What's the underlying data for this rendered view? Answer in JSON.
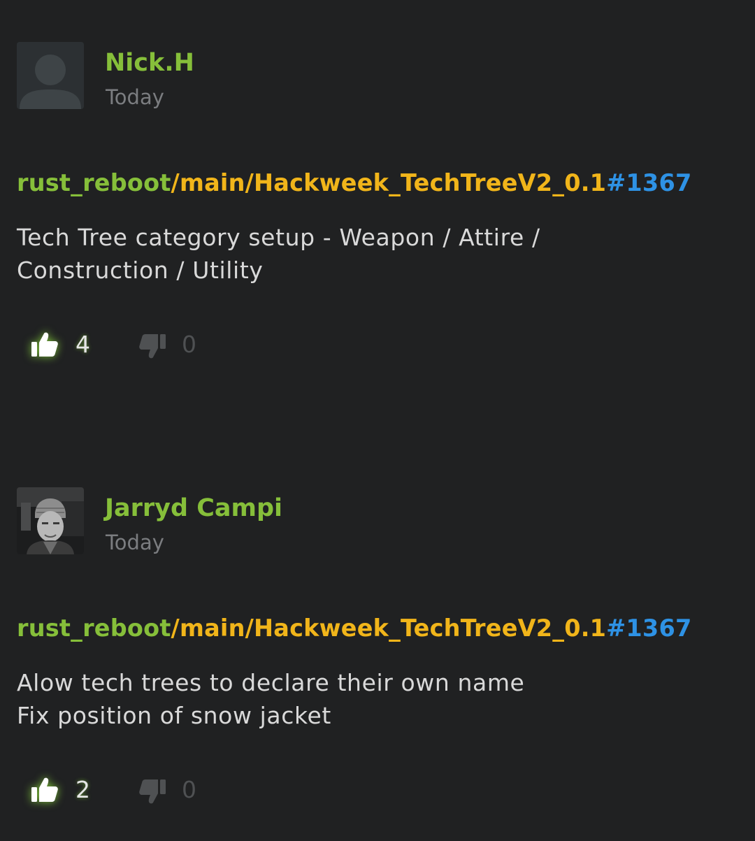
{
  "commits": [
    {
      "author": "Nick.H",
      "time": "Today",
      "avatar": "default-avatar",
      "repo": "rust_reboot",
      "branch": "/main/Hackweek_TechTreeV2_0.1",
      "changelist": "#1367",
      "message_lines": [
        "Tech Tree category setup - Weapon / Attire /",
        "Construction / Utility"
      ],
      "upvotes": "4",
      "downvotes": "0"
    },
    {
      "author": "Jarryd Campi",
      "time": "Today",
      "avatar": "photo-avatar",
      "repo": "rust_reboot",
      "branch": "/main/Hackweek_TechTreeV2_0.1",
      "changelist": "#1367",
      "message_lines": [
        "Alow tech trees to declare their own name",
        "Fix position of snow jacket"
      ],
      "upvotes": "2",
      "downvotes": "0"
    }
  ],
  "colors": {
    "background": "#202122",
    "author": "#86bf3a",
    "repo": "#86bf3a",
    "branch": "#f1b51a",
    "changelist": "#2e92e5",
    "time": "#7b7d80",
    "message": "#d9d9d9",
    "upvote_glow": "#8cdc3c",
    "downvote": "#4f5153"
  },
  "icons": {
    "upvote": "thumbs-up-icon",
    "downvote": "thumbs-down-icon"
  }
}
